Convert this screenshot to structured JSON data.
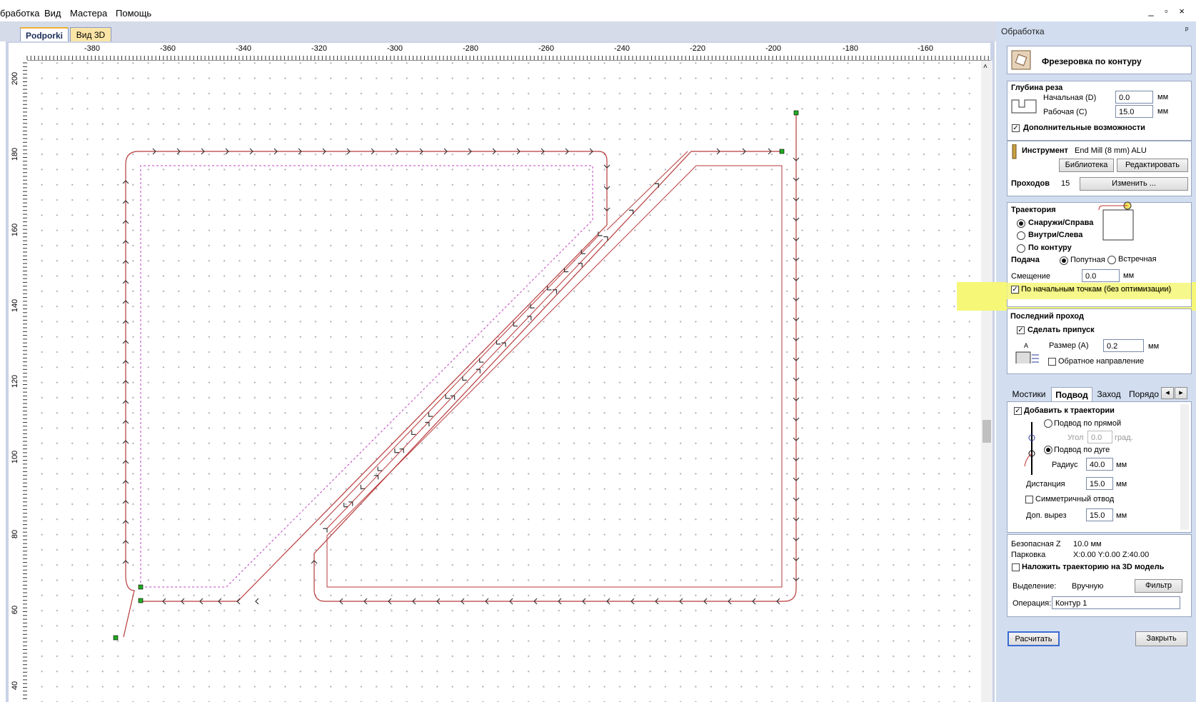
{
  "menu": {
    "items": [
      "бработка",
      "Вид",
      "Мастера",
      "Помощь"
    ],
    "window_controls": "_ ▫ ×"
  },
  "doc_tabs": [
    "Podporki",
    "Вид 3D"
  ],
  "ruler": {
    "top_labels": [
      "-380",
      "-360",
      "-340",
      "-320",
      "-300",
      "-280",
      "-260",
      "-240",
      "-220",
      "-200",
      "-180",
      "-160"
    ],
    "left_labels": [
      "200",
      "180",
      "160",
      "140",
      "120",
      "100",
      "80",
      "60",
      "40"
    ]
  },
  "panel": {
    "title": "Обработка",
    "pin": "ᵖ",
    "op_title": "Фрезеровка по контуру",
    "depth": {
      "header": "Глубина реза",
      "start_label": "Начальная (D)",
      "start_value": "0.0",
      "work_label": "Рабочая (С)",
      "work_value": "15.0",
      "unit": "мм",
      "extra_label": "Дополнительные возможности"
    },
    "tool": {
      "label": "Инструмент",
      "value": "End Mill (8 mm) ALU",
      "library_btn": "Библиотека",
      "edit_btn": "Редактировать",
      "passes_label": "Проходов",
      "passes_value": "15",
      "change_btn": "Изменить ..."
    },
    "path": {
      "header": "Траектория",
      "opt_outside": "Снаружи/Справа",
      "opt_inside": "Внутри/Слева",
      "opt_on": "По контуру",
      "feed_label": "Подача",
      "feed_climb": "Попутная",
      "feed_conv": "Встречная",
      "offset_label": "Смещение",
      "offset_value": "0.0",
      "offset_unit": "мм",
      "startpts_label": "По начальным точкам (без оптимизации)"
    },
    "last_pass": {
      "header": "Последний проход",
      "allowance_label": "Сделать припуск",
      "size_label": "Размер (А)",
      "size_value": "0.2",
      "unit": "мм",
      "reverse_label": "Обратное направление"
    },
    "subtabs": [
      "Мостики",
      "Подвод",
      "Заход",
      "Порядо"
    ],
    "leadin": {
      "add_label": "Добавить к траектории",
      "straight_label": "Подвод по прямой",
      "angle_label": "Угол",
      "angle_value": "0.0",
      "angle_unit": "град.",
      "arc_label": "Подвод по дуге",
      "radius_label": "Радиус",
      "radius_value": "40.0",
      "distance_label": "Дистанция",
      "distance_value": "15.0",
      "sym_label": "Симметричный отвод",
      "extra_cut_label": "Доп. вырез",
      "extra_cut_value": "15.0",
      "unit": "мм"
    },
    "misc": {
      "safe_z_label": "Безопасная Z",
      "safe_z_value": "10.0 мм",
      "park_label": "Парковка",
      "park_value": "X:0.00 Y:0.00 Z:40.00",
      "project3d_label": "Наложить траекторию на 3D модель",
      "selection_label": "Выделение:",
      "selection_value": "Вручную",
      "filter_btn": "Фильтр",
      "operation_label": "Операция:",
      "operation_value": "Контур 1"
    },
    "calc_btn": "Расчитать",
    "close_btn": "Закрыть"
  },
  "colors": {
    "toolpath": "#b83a3a",
    "vector_selected": "#c040c0",
    "node": "#22aa22",
    "highlight": "#f6f777",
    "panel_bg": "#d2def0"
  }
}
